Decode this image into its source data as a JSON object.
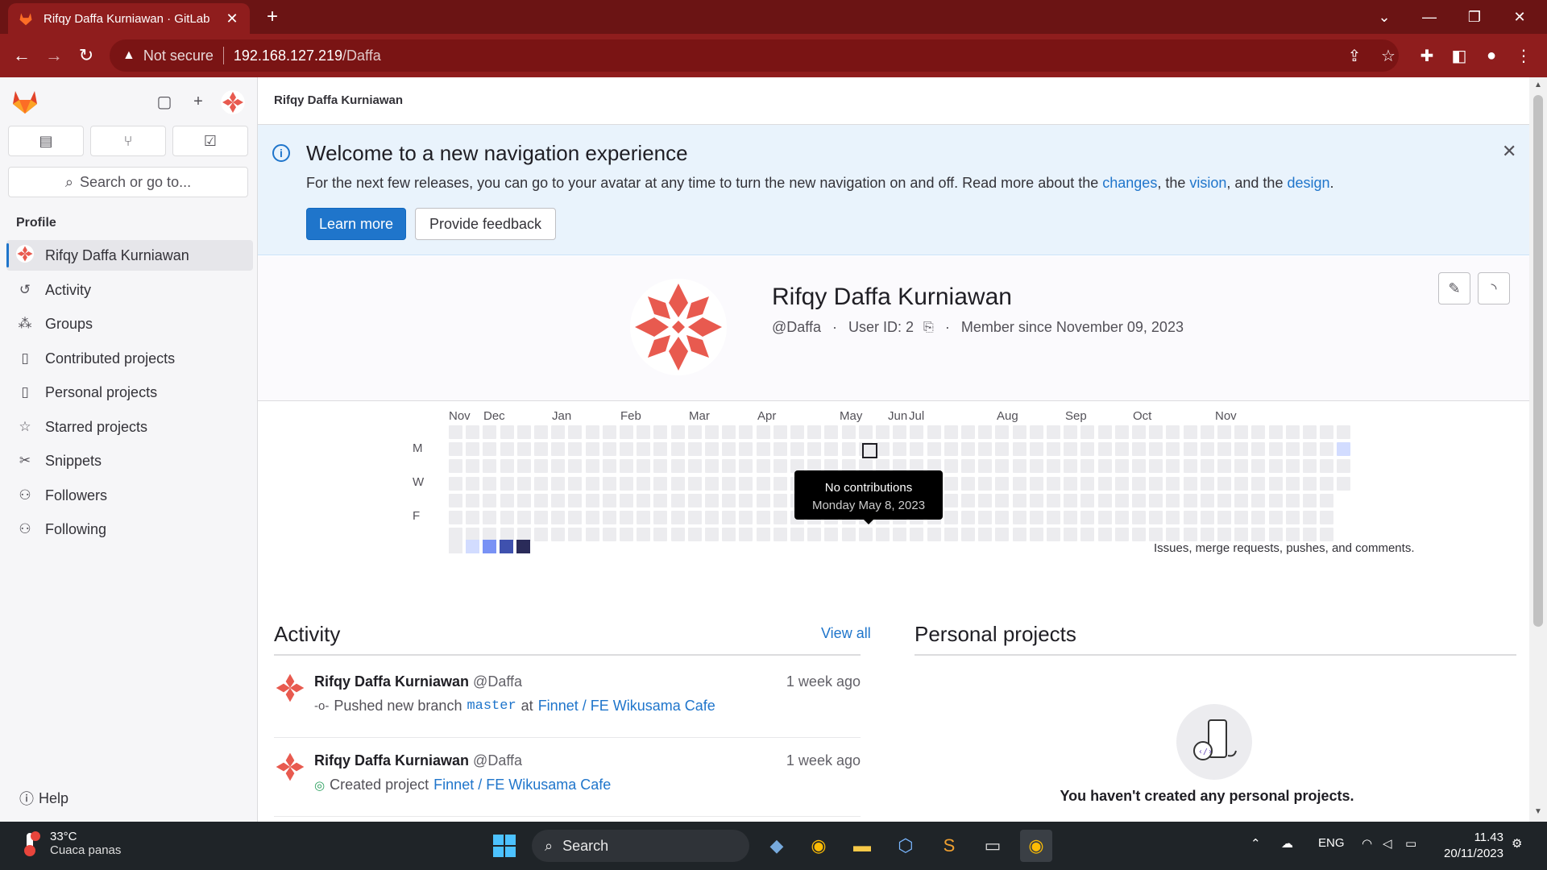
{
  "browser": {
    "tab_title": "Rifqy Daffa Kurniawan · GitLab",
    "not_secure": "Not secure",
    "url_host": "192.168.127.219",
    "url_path": "/Daffa"
  },
  "sidebar": {
    "search_placeholder": "Search or go to...",
    "section": "Profile",
    "items": [
      {
        "label": "Rifqy Daffa Kurniawan",
        "icon": "avatar"
      },
      {
        "label": "Activity",
        "icon": "history-icon"
      },
      {
        "label": "Groups",
        "icon": "groups-icon"
      },
      {
        "label": "Contributed projects",
        "icon": "project-icon"
      },
      {
        "label": "Personal projects",
        "icon": "project-icon"
      },
      {
        "label": "Starred projects",
        "icon": "star-icon"
      },
      {
        "label": "Snippets",
        "icon": "snippet-icon"
      },
      {
        "label": "Followers",
        "icon": "users-icon"
      },
      {
        "label": "Following",
        "icon": "users-icon"
      }
    ],
    "help": "Help"
  },
  "breadcrumb": "Rifqy Daffa Kurniawan",
  "banner": {
    "title": "Welcome to a new navigation experience",
    "text_before": "For the next few releases, you can go to your avatar at any time to turn the new navigation on and off. Read more about the ",
    "link_changes": "changes",
    "text_mid1": ", the ",
    "link_vision": "vision",
    "text_mid2": ", and the ",
    "link_design": "design",
    "text_end": ".",
    "learn_more": "Learn more",
    "feedback": "Provide feedback"
  },
  "profile": {
    "name": "Rifqy Daffa Kurniawan",
    "handle": "@Daffa",
    "user_id": "User ID: 2",
    "member_since": "Member since November 09, 2023"
  },
  "calendar": {
    "months": [
      "Nov",
      "Dec",
      "Jan",
      "Feb",
      "Mar",
      "Apr",
      "May",
      "Jun",
      "Jul",
      "Aug",
      "Sep",
      "Oct",
      "Nov"
    ],
    "days": [
      "M",
      "W",
      "F"
    ],
    "tooltip_title": "No contributions",
    "tooltip_date": "Monday May 8, 2023",
    "legend_text": "Issues, merge requests, pushes, and comments.",
    "legend_colors": [
      "#ececef",
      "#d2dcff",
      "#7992f5",
      "#3f51ae",
      "#2a2b59"
    ]
  },
  "activity": {
    "title": "Activity",
    "view_all": "View all",
    "items": [
      {
        "name": "Rifqy Daffa Kurniawan",
        "handle": "@Daffa",
        "time": "1 week ago",
        "action": "Pushed new branch",
        "branch": "master",
        "connector": "at",
        "project": "Finnet / FE Wikusama Cafe"
      },
      {
        "name": "Rifqy Daffa Kurniawan",
        "handle": "@Daffa",
        "time": "1 week ago",
        "action": "Created project",
        "project": "Finnet / FE Wikusama Cafe"
      }
    ]
  },
  "personal_projects": {
    "title": "Personal projects",
    "empty": "You haven't created any personal projects."
  },
  "taskbar": {
    "temp": "33°C",
    "condition": "Cuaca panas",
    "search": "Search",
    "lang": "ENG",
    "time": "11.43",
    "date": "20/11/2023"
  },
  "colors": {
    "browser_frame": "#8f1d1d",
    "accent": "#1f75cb",
    "gitlab_orange": "#e24329"
  }
}
